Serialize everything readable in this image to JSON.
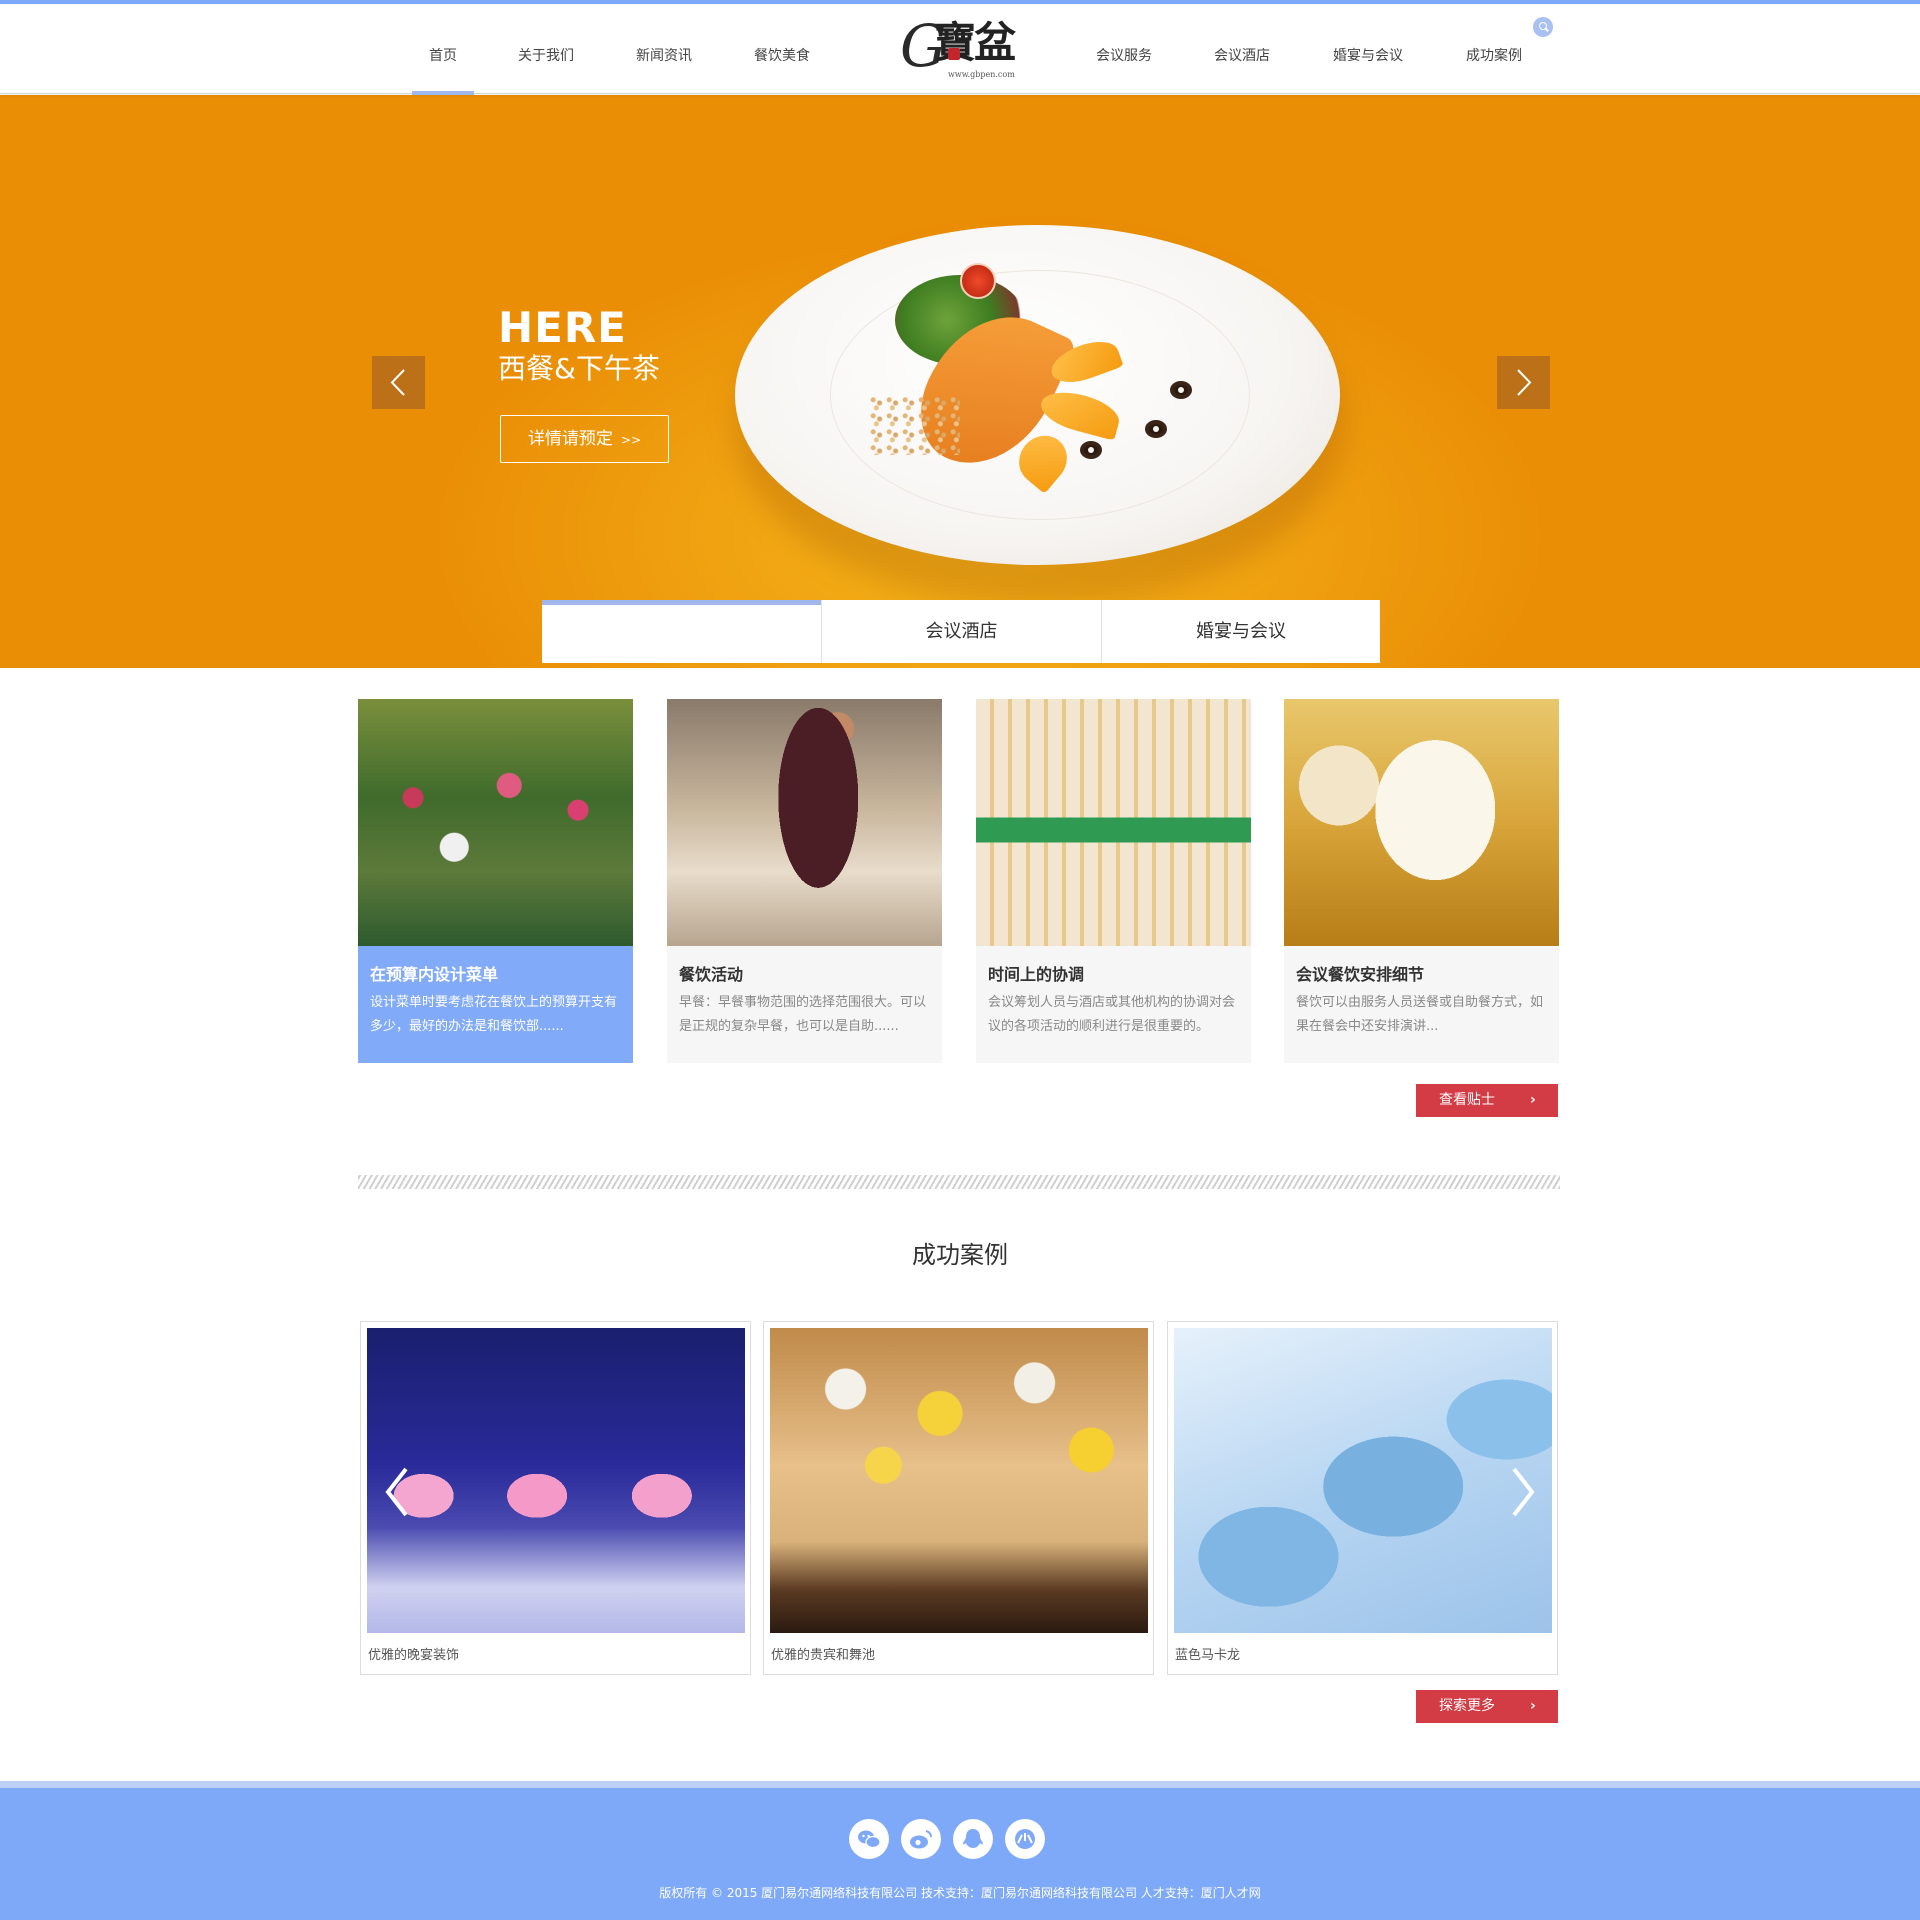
{
  "nav": {
    "left": [
      {
        "label": "首页",
        "active": true
      },
      {
        "label": "关于我们"
      },
      {
        "label": "新闻资讯"
      },
      {
        "label": "餐饮美食"
      }
    ],
    "right": [
      {
        "label": "会议服务"
      },
      {
        "label": "会议酒店"
      },
      {
        "label": "婚宴与会议"
      },
      {
        "label": "成功案例"
      }
    ],
    "logo": {
      "mark": "G",
      "name": "寶盆",
      "url": "www.gbpen.com"
    },
    "search_icon": "search-icon"
  },
  "banner": {
    "title": "HERE",
    "subtitle": "西餐&下午茶",
    "button_label": "详情请预定",
    "button_arrow": ">>",
    "prev_icon": "chevron-left-icon",
    "next_icon": "chevron-right-icon",
    "background": "#ef9f0f"
  },
  "tabs": [
    {
      "label": "",
      "active": true
    },
    {
      "label": "会议酒店"
    },
    {
      "label": "婚宴与会议"
    }
  ],
  "tips": {
    "cards": [
      {
        "title": "在预算内设计菜单",
        "desc": "设计菜单时要考虑花在餐饮上的预算开支有多少，最好的办法是和餐饮部......",
        "highlight": true
      },
      {
        "title": "餐饮活动",
        "desc": "早餐：早餐事物范围的选择范围很大。可以是正规的复杂早餐，也可以是自助......"
      },
      {
        "title": "时间上的协调",
        "desc": "会议筹划人员与酒店或其他机构的协调对会议的各项活动的顺利进行是很重要的。"
      },
      {
        "title": "会议餐饮安排细节",
        "desc": "餐饮可以由服务人员送餐或自助餐方式，如果在餐会中还安排演讲..."
      }
    ],
    "more_label": "查看贴士",
    "more_icon": "chevron-right-icon"
  },
  "cases": {
    "title": "成功案例",
    "items": [
      {
        "caption": "优雅的晚宴装饰"
      },
      {
        "caption": "优雅的贵宾和舞池"
      },
      {
        "caption": "蓝色马卡龙"
      }
    ],
    "more_label": "探索更多",
    "prev_icon": "chevron-left-icon",
    "next_icon": "chevron-right-icon"
  },
  "footer": {
    "social": [
      "wechat-icon",
      "weibo-icon",
      "qq-icon",
      "renren-icon"
    ],
    "copyright": "版权所有 © 2015 厦门易尔通网络科技有限公司  技术支持：厦门易尔通网络科技有限公司 人才支持：厦门人才网",
    "accent": "#7ea9f8"
  },
  "colors": {
    "accent": "#9fb7ea",
    "red_button": "#d33b45",
    "highlight_card": "#81aaf9"
  }
}
